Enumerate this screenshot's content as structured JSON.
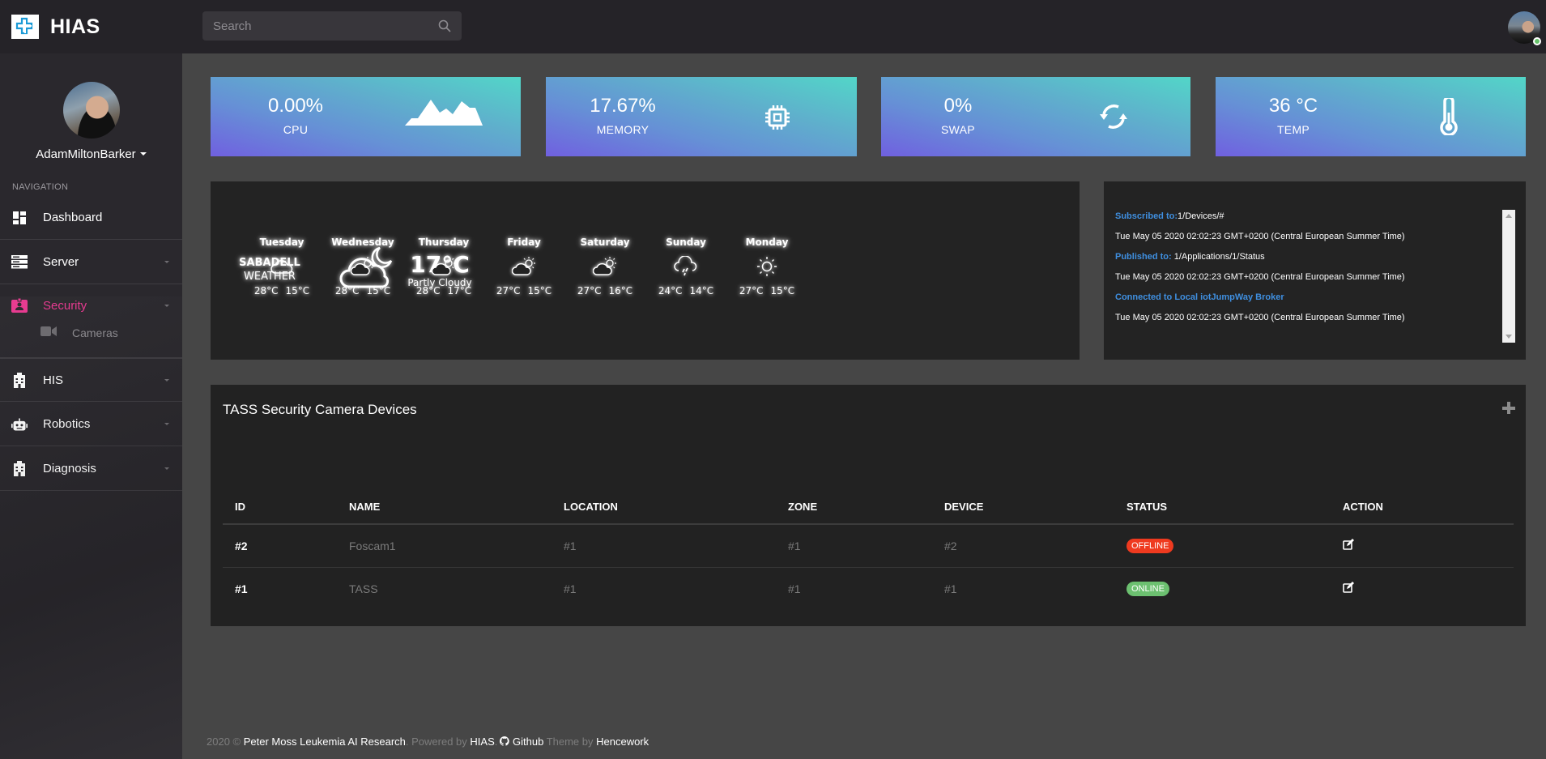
{
  "header": {
    "app_name": "HIAS",
    "search_placeholder": "Search",
    "user_online": true
  },
  "sidebar": {
    "username": "AdamMiltonBarker",
    "nav_heading": "NAVIGATION",
    "items": [
      {
        "label": "Dashboard",
        "icon": "dashboard-icon",
        "has_caret": false,
        "active": false
      },
      {
        "label": "Server",
        "icon": "server-icon",
        "has_caret": true,
        "active": false
      },
      {
        "label": "Security",
        "icon": "id-badge-icon",
        "has_caret": true,
        "active": true
      },
      {
        "label": "HIS",
        "icon": "hospital-icon",
        "has_caret": true,
        "active": false
      },
      {
        "label": "Robotics",
        "icon": "robot-icon",
        "has_caret": true,
        "active": false
      },
      {
        "label": "Diagnosis",
        "icon": "hospital-icon",
        "has_caret": true,
        "active": false
      }
    ],
    "sub_items": [
      {
        "parent": "Security",
        "label": "Cameras",
        "icon": "video-camera-icon"
      }
    ],
    "accent_color": "#e8388f"
  },
  "stats": [
    {
      "value": "0.00%",
      "label": "CPU",
      "icon": "area-chart-icon"
    },
    {
      "value": "17.67%",
      "label": "MEMORY",
      "icon": "microchip-icon"
    },
    {
      "value": "0%",
      "label": "SWAP",
      "icon": "refresh-icon"
    },
    {
      "value": "36 °C",
      "label": "TEMP",
      "icon": "thermometer-icon"
    }
  ],
  "weather": {
    "city": "SABADELL",
    "subtitle": "WEATHER",
    "current_temp": "17°C",
    "current_condition": "Partly Cloudy",
    "current_icon": "cloud-moon-icon",
    "forecast": [
      {
        "day": "Tuesday",
        "icon": "cloud-icon",
        "high": "28°C",
        "low": "15°C"
      },
      {
        "day": "Wednesday",
        "icon": "cloud-sun-icon",
        "high": "28°C",
        "low": "15°C"
      },
      {
        "day": "Thursday",
        "icon": "cloud-sun-icon",
        "high": "28°C",
        "low": "17°C"
      },
      {
        "day": "Friday",
        "icon": "cloud-sun-icon",
        "high": "27°C",
        "low": "15°C"
      },
      {
        "day": "Saturday",
        "icon": "cloud-sun-icon",
        "high": "27°C",
        "low": "16°C"
      },
      {
        "day": "Sunday",
        "icon": "cloud-rain-icon",
        "high": "24°C",
        "low": "14°C"
      },
      {
        "day": "Monday",
        "icon": "sun-icon",
        "high": "27°C",
        "low": "15°C"
      }
    ]
  },
  "mqtt_log": [
    {
      "label": "Subscribed to:",
      "text": "1/Devices/#"
    },
    {
      "label": "",
      "text": "Tue May 05 2020 02:02:23 GMT+0200 (Central European Summer Time)"
    },
    {
      "label": "Published to:",
      "text": " 1/Applications/1/Status"
    },
    {
      "label": "",
      "text": "Tue May 05 2020 02:02:23 GMT+0200 (Central European Summer Time)"
    },
    {
      "label": "Connected to Local iotJumpWay Broker",
      "text": ""
    },
    {
      "label": "",
      "text": "Tue May 05 2020 02:02:23 GMT+0200 (Central European Summer Time)"
    }
  ],
  "devices_table": {
    "title": "TASS Security Camera Devices",
    "columns": [
      "ID",
      "NAME",
      "LOCATION",
      "ZONE",
      "DEVICE",
      "STATUS",
      "ACTION"
    ],
    "rows": [
      {
        "id": "#2",
        "name": "Foscam1",
        "location": "#1",
        "zone": "#1",
        "device": "#2",
        "status": "OFFLINE",
        "status_color": "#ef3a1f"
      },
      {
        "id": "#1",
        "name": "TASS",
        "location": "#1",
        "zone": "#1",
        "device": "#1",
        "status": "ONLINE",
        "status_color": "#6cc070"
      }
    ]
  },
  "footer": {
    "year": "2020 ©",
    "org": "Peter Moss Leukemia AI Research",
    "powered_by": ". Powered by",
    "app": "HIAS",
    "github": "Github",
    "theme_by": "Theme by",
    "theme_author": "Hencework"
  }
}
